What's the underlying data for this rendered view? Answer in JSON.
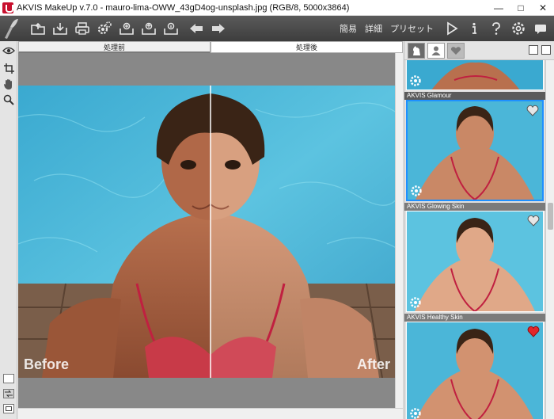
{
  "window": {
    "title": "AKVIS MakeUp v.7.0 - mauro-lima-OWW_43gD4og-unsplash.jpg (RGB/8, 5000x3864)",
    "controls": [
      "—",
      "□",
      "✕"
    ]
  },
  "toolbar": {
    "icons": [
      "open-icon",
      "save-icon",
      "print-icon",
      "settings-gear-icon",
      "batch-icon",
      "share-icon",
      "info-sticker-icon",
      "undo-arrow-icon",
      "redo-arrow-icon"
    ],
    "mode_simple": "簡易",
    "mode_advanced": "詳細",
    "presets_label": "プリセット",
    "right_icons": [
      "run-icon",
      "info-icon",
      "help-icon",
      "preferences-icon",
      "message-icon"
    ]
  },
  "tabs": {
    "before": "処理前",
    "after": "処理後"
  },
  "canvas": {
    "before_label": "Before",
    "after_label": "After",
    "split_fraction": 0.5
  },
  "right_panel": {
    "preset_tabs": [
      "horse-icon",
      "person-icon",
      "heart-icon"
    ],
    "presets": [
      {
        "name": "",
        "favorite": false
      },
      {
        "name": "AKVIS Glamour",
        "favorite": false,
        "selected": true
      },
      {
        "name": "AKVIS Glowing Skin",
        "favorite": false
      },
      {
        "name": "AKVIS Healthy Skin",
        "favorite": true
      }
    ]
  },
  "colors": {
    "toolbar_bg": "#4a4a4a",
    "water": "#4bb6d8",
    "skin": "#b96e4c",
    "selected_border": "#1e90ff",
    "heart_red": "#e3262a"
  }
}
